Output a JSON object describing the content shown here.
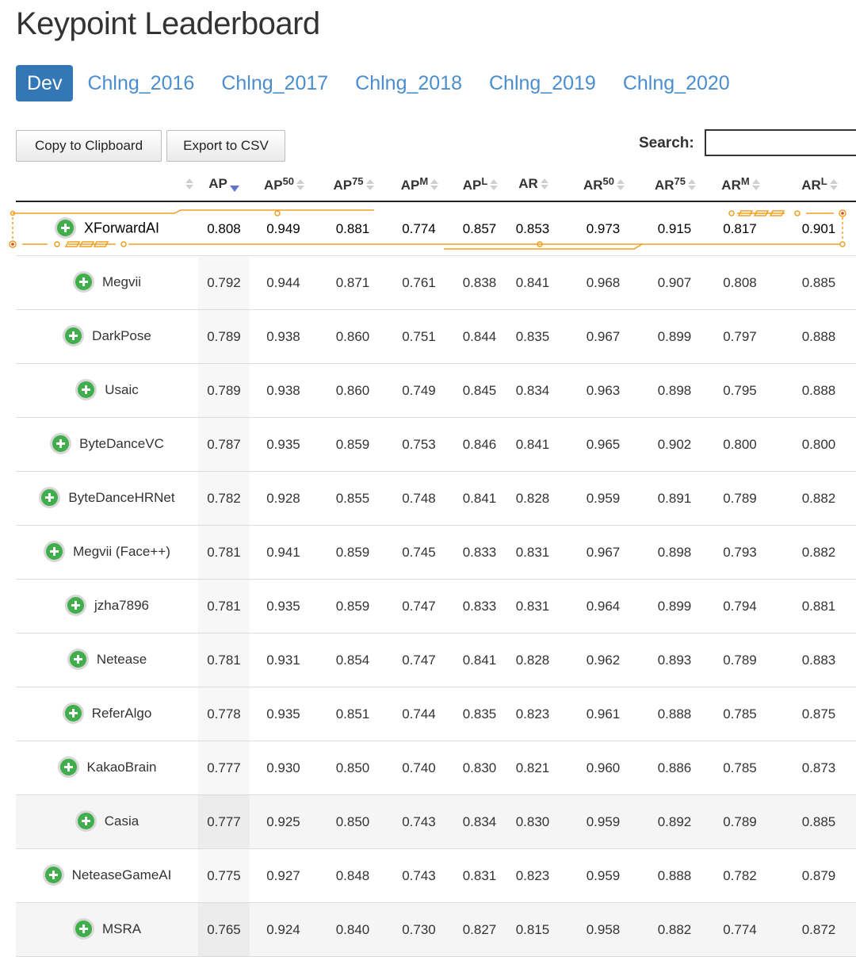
{
  "page": {
    "title": "Keypoint Leaderboard"
  },
  "tabs": [
    "Dev",
    "Chlng_2016",
    "Chlng_2017",
    "Chlng_2018",
    "Chlng_2019",
    "Chlng_2020"
  ],
  "toolbar": {
    "copy_label": "Copy to Clipboard",
    "export_label": "Export to CSV",
    "search_label": "Search:",
    "search_value": ""
  },
  "columns": [
    {
      "key": "AP",
      "base": "AP",
      "sup": ""
    },
    {
      "key": "AP50",
      "base": "AP",
      "sup": "50"
    },
    {
      "key": "AP75",
      "base": "AP",
      "sup": "75"
    },
    {
      "key": "APM",
      "base": "AP",
      "sup": "M"
    },
    {
      "key": "APL",
      "base": "AP",
      "sup": "L"
    },
    {
      "key": "AR",
      "base": "AR",
      "sup": ""
    },
    {
      "key": "AR50",
      "base": "AR",
      "sup": "50"
    },
    {
      "key": "AR75",
      "base": "AR",
      "sup": "75"
    },
    {
      "key": "ARM",
      "base": "AR",
      "sup": "M"
    },
    {
      "key": "ARL",
      "base": "AR",
      "sup": "L"
    }
  ],
  "sorted_column": "AP",
  "colors": {
    "accent": "#3477b6",
    "link": "#4a8ed0",
    "plus": "#3fae4b",
    "highlight_frame": "#f0a020",
    "sort_arrow": "#6476c8"
  },
  "rows": [
    {
      "name": "XForwardAI",
      "values": [
        "0.808",
        "0.949",
        "0.881",
        "0.774",
        "0.857",
        "0.853",
        "0.973",
        "0.915",
        "0.817",
        "0.901"
      ],
      "highlight": true
    },
    {
      "name": "Megvii",
      "values": [
        "0.792",
        "0.944",
        "0.871",
        "0.761",
        "0.838",
        "0.841",
        "0.968",
        "0.907",
        "0.808",
        "0.885"
      ]
    },
    {
      "name": "DarkPose",
      "values": [
        "0.789",
        "0.938",
        "0.860",
        "0.751",
        "0.844",
        "0.835",
        "0.967",
        "0.899",
        "0.797",
        "0.888"
      ]
    },
    {
      "name": "Usaic",
      "values": [
        "0.789",
        "0.938",
        "0.860",
        "0.749",
        "0.845",
        "0.834",
        "0.963",
        "0.898",
        "0.795",
        "0.888"
      ]
    },
    {
      "name": "ByteDanceVC",
      "values": [
        "0.787",
        "0.935",
        "0.859",
        "0.753",
        "0.846",
        "0.841",
        "0.965",
        "0.902",
        "0.800",
        "0.800"
      ]
    },
    {
      "name": "ByteDanceHRNet",
      "values": [
        "0.782",
        "0.928",
        "0.855",
        "0.748",
        "0.841",
        "0.828",
        "0.959",
        "0.891",
        "0.789",
        "0.882"
      ]
    },
    {
      "name": "Megvii (Face++)",
      "values": [
        "0.781",
        "0.941",
        "0.859",
        "0.745",
        "0.833",
        "0.831",
        "0.967",
        "0.898",
        "0.793",
        "0.882"
      ]
    },
    {
      "name": "jzha7896",
      "values": [
        "0.781",
        "0.935",
        "0.859",
        "0.747",
        "0.833",
        "0.831",
        "0.964",
        "0.899",
        "0.794",
        "0.881"
      ]
    },
    {
      "name": "Netease",
      "values": [
        "0.781",
        "0.931",
        "0.854",
        "0.747",
        "0.841",
        "0.828",
        "0.962",
        "0.893",
        "0.789",
        "0.883"
      ]
    },
    {
      "name": "ReferAlgo",
      "values": [
        "0.778",
        "0.935",
        "0.851",
        "0.744",
        "0.835",
        "0.823",
        "0.961",
        "0.888",
        "0.785",
        "0.875"
      ]
    },
    {
      "name": "KakaoBrain",
      "values": [
        "0.777",
        "0.930",
        "0.850",
        "0.740",
        "0.830",
        "0.821",
        "0.960",
        "0.886",
        "0.785",
        "0.873"
      ]
    },
    {
      "name": "Casia",
      "values": [
        "0.777",
        "0.925",
        "0.850",
        "0.743",
        "0.834",
        "0.830",
        "0.959",
        "0.892",
        "0.789",
        "0.885"
      ],
      "alt": true
    },
    {
      "name": "NeteaseGameAI",
      "values": [
        "0.775",
        "0.927",
        "0.848",
        "0.743",
        "0.831",
        "0.823",
        "0.959",
        "0.888",
        "0.782",
        "0.879"
      ]
    },
    {
      "name": "MSRA",
      "values": [
        "0.765",
        "0.924",
        "0.840",
        "0.730",
        "0.827",
        "0.815",
        "0.958",
        "0.882",
        "0.774",
        "0.872"
      ],
      "alt": true
    }
  ]
}
